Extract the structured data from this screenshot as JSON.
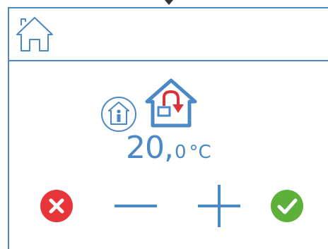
{
  "header": {
    "home_icon": "home-outline-icon"
  },
  "mode": {
    "info_icon": "person-in-house-info-icon",
    "mode_icon": "house-return-arrow-icon"
  },
  "temperature": {
    "integer": "20,",
    "decimal": "0",
    "unit": "°C"
  },
  "controls": {
    "cancel_icon": "cancel-x-icon",
    "minus_icon": "minus-icon",
    "plus_icon": "plus-icon",
    "confirm_icon": "check-icon"
  },
  "colors": {
    "accent_blue": "#4a88c6",
    "cancel_red": "#e8343a",
    "confirm_green": "#5db13b",
    "arrow_red": "#d9323a"
  }
}
